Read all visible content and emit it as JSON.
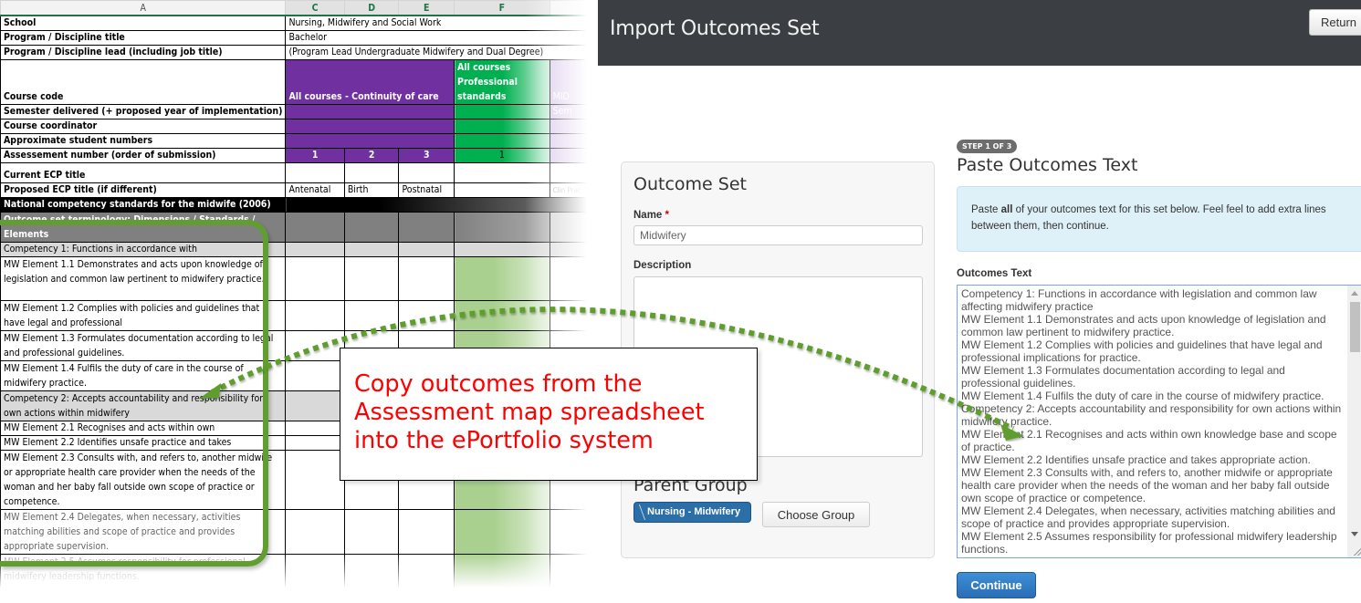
{
  "spreadsheet": {
    "column_headers": [
      "A",
      "C",
      "D",
      "E",
      "F",
      ""
    ],
    "rows": {
      "school": {
        "label": "School",
        "value": "Nursing, Midwifery and Social Work"
      },
      "program_title": {
        "label": "Program / Discipline title",
        "value": "Bachelor"
      },
      "program_lead": {
        "label": "Program / Discipline lead (including job title)",
        "value": " (Program Lead Undergraduate Midwifery and Dual Degree)"
      },
      "course_code": {
        "label": "Course code",
        "purple": "All courses - Continuity of care",
        "green": "All courses Professional standards",
        "lilac": "MID"
      },
      "semester": {
        "label": "Semester delivered (+ proposed year of implementation)",
        "lilac": "Sem"
      },
      "coordinator": {
        "label": "Course coordinator"
      },
      "student_numbers": {
        "label": "Approximate student numbers"
      },
      "assessment_number": {
        "label": "Assessement number (order of submission)",
        "values": [
          "1",
          "2",
          "3",
          "1"
        ]
      },
      "current_ecp": {
        "label": "Current ECP title"
      },
      "proposed_ecp": {
        "label": "Proposed ECP title (if different)",
        "values": [
          "Antenatal",
          "Birth",
          "Postnatal",
          "",
          "Clin Prac"
        ]
      },
      "national_standards": {
        "label": "National competency standards for the midwife (2006)"
      },
      "terminology": {
        "label": "Outcome set terminology: Dimensions / Standards / Elements"
      }
    },
    "outcomes": [
      {
        "text": "Competency 1: Functions in accordance with",
        "type": "competency"
      },
      {
        "text": "MW Element 1.1 Demonstrates and acts upon knowledge of legislation and common law pertinent to midwifery practice.",
        "type": "element"
      },
      {
        "text": "MW Element 1.2 Complies with policies and guidelines that have legal and professional",
        "type": "element"
      },
      {
        "text": "MW Element 1.3 Formulates documentation according to legal and professional guidelines.",
        "type": "element"
      },
      {
        "text": "MW Element 1.4 Fulfils the duty of care in the course of midwifery practice.",
        "type": "element"
      },
      {
        "text": "Competency 2: Accepts accountability and responsibility for own actions within midwifery",
        "type": "competency"
      },
      {
        "text": "MW Element 2.1 Recognises and acts within own",
        "type": "element"
      },
      {
        "text": "MW Element 2.2 Identifies unsafe practice and takes",
        "type": "element"
      },
      {
        "text": "MW Element 2.3 Consults with, and refers to, another midwife or appropriate health care provider when the needs of the woman and her baby fall outside own scope of practice or competence.",
        "type": "element"
      },
      {
        "text": "MW Element 2.4 Delegates, when necessary, activities matching abilities and scope of practice and provides appropriate supervision.",
        "type": "element"
      },
      {
        "text": "MW Element 2.5 Assumes responsibility for professional midwifery leadership functions.",
        "type": "element"
      }
    ]
  },
  "app": {
    "title": "Import Outcomes Set",
    "return_label": "Return",
    "outcome_set": {
      "heading": "Outcome Set",
      "name_label": "Name",
      "required_mark": "*",
      "name_value": "Midwifery",
      "description_label": "Description",
      "description_value": "",
      "parent_group_heading": "Parent Group",
      "parent_group_value": "Nursing - Midwifery",
      "choose_group_label": "Choose Group"
    },
    "step": {
      "badge": "STEP 1 OF 3",
      "title": "Paste Outcomes Text",
      "info_pre": "Paste ",
      "info_bold": "all",
      "info_post": " of your outcomes text for this set below. Feel feel to add extra lines between them, then continue.",
      "outcomes_label": "Outcomes Text",
      "outcomes_value": "Competency 1: Functions in accordance with legislation and common law affecting midwifery practice\nMW Element 1.1 Demonstrates and acts upon knowledge of legislation and common law pertinent to midwifery practice.\nMW Element 1.2 Complies with policies and guidelines that have legal and professional implications for practice.\nMW Element 1.3 Formulates documentation according to legal and professional guidelines.\nMW Element 1.4 Fulfils the duty of care in the course of midwifery practice.\nCompetency 2: Accepts accountability and responsibility for own actions within midwifery practice.\nMW Element 2.1 Recognises and acts within own knowledge base and scope of practice.\nMW Element 2.2 Identifies unsafe practice and takes appropriate action.\nMW Element 2.3 Consults with, and refers to, another midwife or appropriate health care provider when the needs of the woman and her baby fall outside own scope of practice or competence.\nMW Element 2.4 Delegates, when necessary, activities matching abilities and scope of practice and provides appropriate supervision.\nMW Element 2.5 Assumes responsibility for professional midwifery leadership functions.",
      "continue_label": "Continue"
    }
  },
  "callout": {
    "text": "Copy outcomes from the Assessment map spreadsheet into the ePortfolio system",
    "text_color": "#ff0000",
    "arrow_color": "#5f9e2f"
  }
}
